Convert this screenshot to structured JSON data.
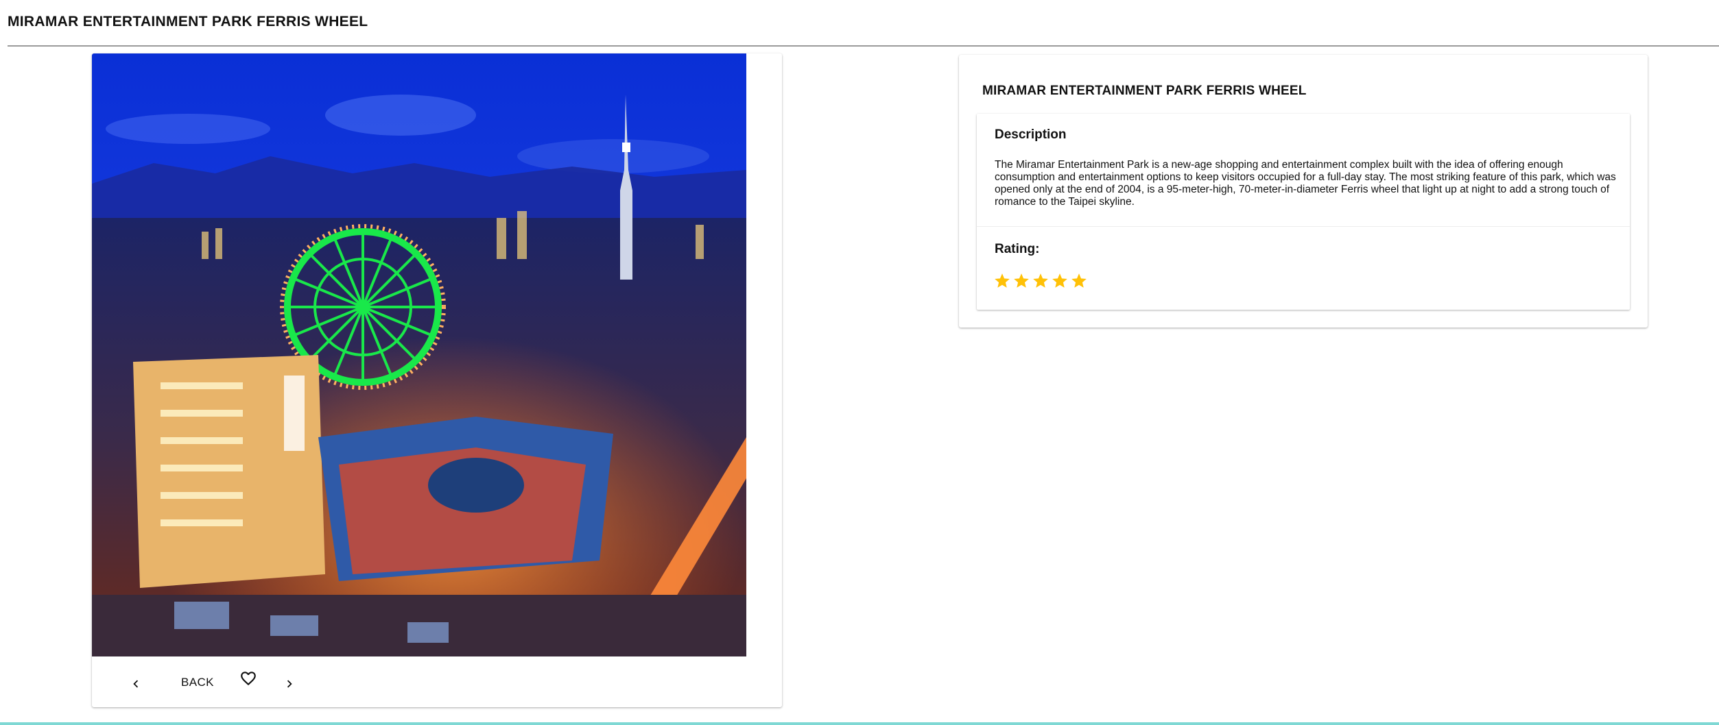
{
  "page": {
    "title": "MIRAMAR ENTERTAINMENT PARK FERRIS WHEEL"
  },
  "photo_card": {
    "back_label": "BACK",
    "prev_icon": "chevron-left-icon",
    "next_icon": "chevron-right-icon",
    "favorite_icon": "heart-outline-icon"
  },
  "detail": {
    "title": "MIRAMAR ENTERTAINMENT PARK FERRIS WHEEL",
    "description_heading": "Description",
    "description_text": "The Miramar Entertainment Park is a new-age shopping and entertainment complex built with the idea of offering enough consumption and entertainment options to keep visitors occupied for a full-day stay. The most striking feature of this park, which was opened only at the end of 2004, is a 95-meter-high, 70-meter-in-diameter Ferris wheel that light up at night to add a strong touch of romance to the Taipei skyline.",
    "rating_heading": "Rating:",
    "rating_value": 5,
    "rating_max": 5
  },
  "colors": {
    "star": "#ffc107",
    "accent_bottom": "#7fd8d4",
    "divider": "#9a9a9a"
  }
}
